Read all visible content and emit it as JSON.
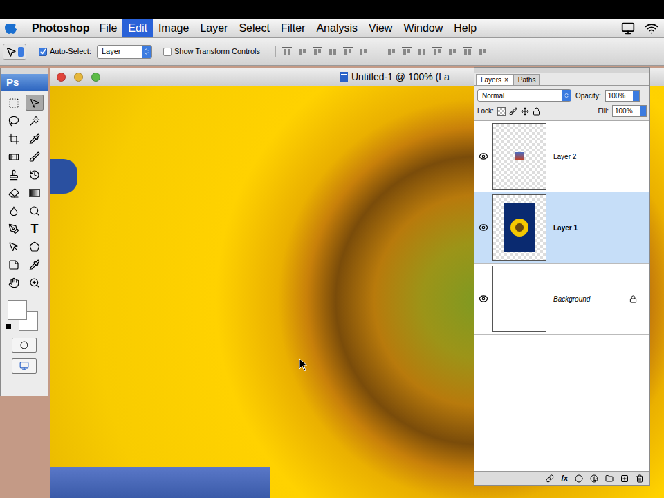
{
  "menu_bar": {
    "app": "Photoshop",
    "items": [
      {
        "label": "File",
        "selected": false
      },
      {
        "label": "Edit",
        "selected": true
      },
      {
        "label": "Image",
        "selected": false
      },
      {
        "label": "Layer",
        "selected": false
      },
      {
        "label": "Select",
        "selected": false
      },
      {
        "label": "Filter",
        "selected": false
      },
      {
        "label": "Analysis",
        "selected": false
      },
      {
        "label": "View",
        "selected": false
      },
      {
        "label": "Window",
        "selected": false
      },
      {
        "label": "Help",
        "selected": false
      }
    ]
  },
  "options_bar": {
    "auto_select": {
      "label": "Auto-Select:",
      "checked": true
    },
    "auto_select_target": "Layer",
    "show_transform_controls": {
      "label": "Show Transform Controls",
      "checked": false
    }
  },
  "toolbox": {
    "logo": "Ps",
    "tools": [
      {
        "kind": "icon",
        "selected": false
      },
      {
        "kind": "icon",
        "selected": true
      },
      {
        "kind": "icon",
        "selected": false
      },
      {
        "kind": "icon",
        "selected": false
      },
      {
        "kind": "icon",
        "selected": false
      },
      {
        "kind": "icon",
        "selected": false
      },
      {
        "kind": "icon",
        "selected": false
      },
      {
        "kind": "icon",
        "selected": false
      },
      {
        "kind": "icon",
        "selected": false
      },
      {
        "kind": "icon",
        "selected": false
      },
      {
        "kind": "icon",
        "selected": false
      },
      {
        "kind": "swatch",
        "selected": false
      },
      {
        "kind": "icon",
        "selected": false
      },
      {
        "kind": "icon",
        "selected": false
      },
      {
        "kind": "icon",
        "selected": false
      },
      {
        "kind": "glyph",
        "glyph": "T",
        "selected": false
      },
      {
        "kind": "icon",
        "selected": false
      },
      {
        "kind": "icon",
        "selected": false
      },
      {
        "kind": "icon",
        "selected": false
      },
      {
        "kind": "icon",
        "selected": false
      },
      {
        "kind": "icon",
        "selected": false
      },
      {
        "kind": "icon",
        "selected": false
      }
    ]
  },
  "document": {
    "title": "Untitled-1 @ 100% (La"
  },
  "layers_panel": {
    "tabs": [
      {
        "label": "Layers",
        "close": "×",
        "selected": true
      },
      {
        "label": "Paths",
        "selected": false
      }
    ],
    "blend_mode": "Normal",
    "opacity_label": "Opacity:",
    "opacity": "100%",
    "lock_label": "Lock:",
    "fill_label": "Fill:",
    "fill": "100%",
    "layers": [
      {
        "name": "Layer 2",
        "kind": "small",
        "visible": true,
        "selected": false,
        "locked": false
      },
      {
        "name": "Layer 1",
        "kind": "photo",
        "visible": true,
        "selected": true,
        "locked": false
      },
      {
        "name": "Background",
        "kind": "white",
        "visible": true,
        "selected": false,
        "locked": true
      }
    ],
    "bottom_bar": {
      "fx": "fx"
    }
  }
}
